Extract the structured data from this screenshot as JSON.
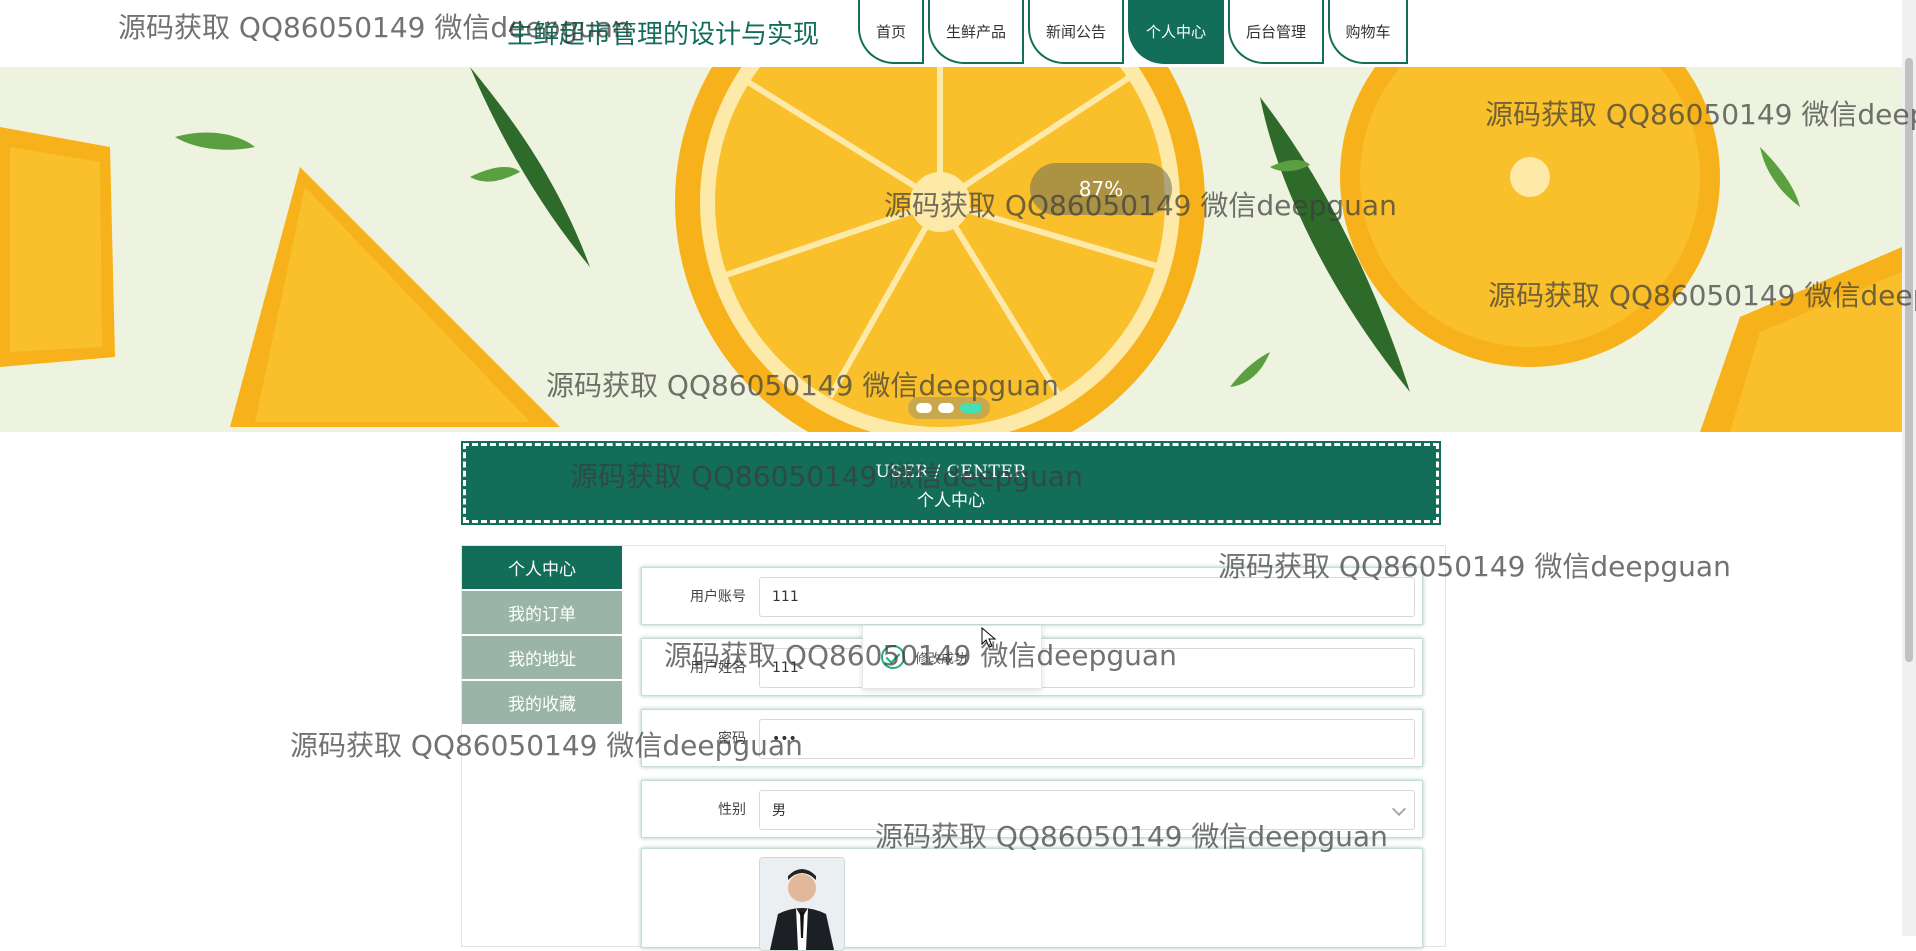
{
  "header": {
    "site_title": "生鲜超市管理的设计与实现",
    "nav": [
      {
        "label": "首页",
        "active": false
      },
      {
        "label": "生鲜产品",
        "active": false
      },
      {
        "label": "新闻公告",
        "active": false
      },
      {
        "label": "个人中心",
        "active": true
      },
      {
        "label": "后台管理",
        "active": false
      },
      {
        "label": "购物车",
        "active": false
      }
    ]
  },
  "banner": {
    "progress_text": "87%",
    "slide_count": 3,
    "active_slide": 3
  },
  "section": {
    "title_en": "USER / CENTER",
    "title_cn": "个人中心"
  },
  "sidebar": {
    "items": [
      {
        "label": "个人中心",
        "active": true
      },
      {
        "label": "我的订单",
        "active": false
      },
      {
        "label": "我的地址",
        "active": false
      },
      {
        "label": "我的收藏",
        "active": false
      }
    ]
  },
  "form": {
    "account_label": "用户账号",
    "account_value": "111",
    "name_label": "用户姓名",
    "name_value": "111",
    "password_label": "密码",
    "password_value": "•••",
    "gender_label": "性别",
    "gender_value": "男"
  },
  "toast": {
    "message": "修改成功"
  },
  "watermark": "源码获取 QQ86050149 微信deepguan",
  "colors": {
    "primary": "#126e58",
    "menu_inactive": "#9ab5a8",
    "accent_dot": "#43e0b8"
  }
}
